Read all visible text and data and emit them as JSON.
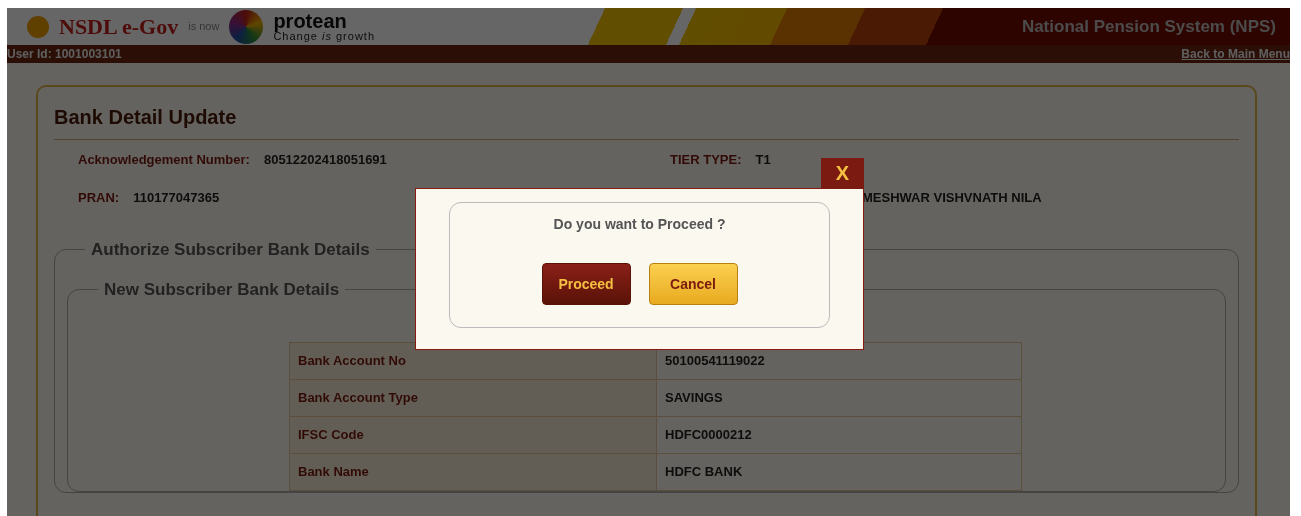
{
  "header": {
    "brand": "NSDL e-Gov",
    "is_now": "is now",
    "new_brand": "protean",
    "tagline": "Change *is* growth",
    "system_title": "National Pension System (NPS)"
  },
  "user_bar": {
    "user_id": "User Id: 1001003101",
    "back_link": "Back to Main Menu"
  },
  "page": {
    "title": "Bank Detail Update",
    "fields": [
      {
        "label": "Acknowledgement Number:",
        "value": "80512202418051691"
      },
      {
        "label": "TIER TYPE:",
        "value": "T1"
      },
      {
        "label": "PRAN:",
        "value": "110177047365"
      },
      {
        "value": "MESHWAR VISHVNATH NILA"
      }
    ],
    "section": {
      "legend": "Authorize Subscriber Bank Details",
      "subsection": {
        "legend": "New Subscriber Bank Details",
        "rows": [
          {
            "label": "Bank Account No",
            "value": "50100541119022"
          },
          {
            "label": "Bank Account Type",
            "value": "SAVINGS"
          },
          {
            "label": "IFSC Code",
            "value": "HDFC0000212"
          },
          {
            "label": "Bank Name",
            "value": "HDFC BANK"
          }
        ]
      }
    }
  },
  "dialog": {
    "close": "X",
    "message": "Do you want to Proceed ?",
    "buttons": [
      {
        "label": "Proceed",
        "kind": "primary"
      },
      {
        "label": "Cancel",
        "kind": "secondary"
      }
    ]
  }
}
